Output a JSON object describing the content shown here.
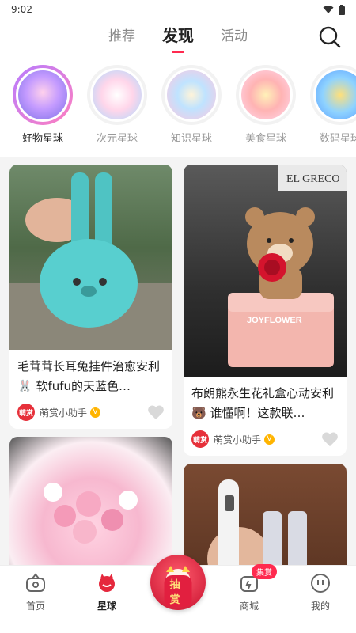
{
  "status": {
    "time": "9:02"
  },
  "top_tabs": [
    {
      "label": "推荐"
    },
    {
      "label": "发现"
    },
    {
      "label": "活动"
    }
  ],
  "planets": [
    {
      "label": "好物星球"
    },
    {
      "label": "次元星球"
    },
    {
      "label": "知识星球"
    },
    {
      "label": "美食星球"
    },
    {
      "label": "数码星球"
    }
  ],
  "feed": {
    "left": [
      {
        "title": "毛茸茸长耳兔挂件治愈安利🐰 软fufu的天蓝色…",
        "author": "萌赏小助手",
        "avatar_text": "萌赏"
      },
      {
        "title": "",
        "author": "",
        "avatar_text": ""
      }
    ],
    "right": [
      {
        "title": "布朗熊永生花礼盒心动安利🐻 谁懂啊！这款联…",
        "author": "萌赏小助手",
        "avatar_text": "萌赏",
        "image_text": "JOYFLOWER",
        "sign_text": "EL GRECO"
      },
      {
        "title": "",
        "author": "",
        "avatar_text": ""
      }
    ]
  },
  "bottom_nav": [
    {
      "label": "首页"
    },
    {
      "label": "星球"
    },
    {
      "label": "抽赏"
    },
    {
      "label": "商城",
      "badge": "集赏"
    },
    {
      "label": "我的"
    }
  ],
  "colors": {
    "accent": "#ff2a4f",
    "vip": "#ffb400"
  }
}
